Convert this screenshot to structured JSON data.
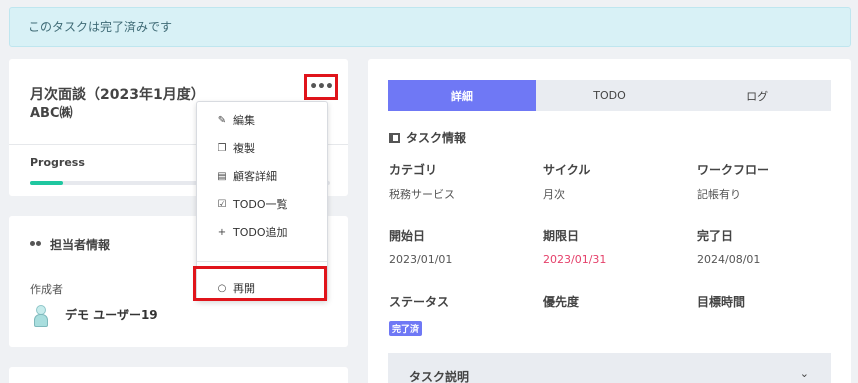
{
  "alert": {
    "text": "このタスクは完了済みです"
  },
  "task": {
    "title": "月次面談（2023年1月度）",
    "client": "ABC㈱",
    "progress_label": "Progress",
    "progress_value": 0.11,
    "more_label": "•••"
  },
  "menu": {
    "items": [
      {
        "icon": "pencil-icon",
        "label": "編集"
      },
      {
        "icon": "copy-icon",
        "label": "複製"
      },
      {
        "icon": "document-icon",
        "label": "顧客詳細"
      },
      {
        "icon": "checkbox-icon",
        "label": "TODO一覧"
      },
      {
        "icon": "plus-icon",
        "label": "TODO追加"
      }
    ],
    "reopen": {
      "icon": "circle-icon",
      "label": "再開"
    }
  },
  "assignee": {
    "section_title": "担当者情報",
    "creator_label": "作成者",
    "creator_name": "デモ ユーザー19"
  },
  "tabs": [
    {
      "label": "詳細",
      "active": true
    },
    {
      "label": "TODO",
      "active": false
    },
    {
      "label": "ログ",
      "active": false
    }
  ],
  "info": {
    "section_title": "タスク情報",
    "category": {
      "label": "カテゴリ",
      "value": "税務サービス"
    },
    "cycle": {
      "label": "サイクル",
      "value": "月次"
    },
    "workflow": {
      "label": "ワークフロー",
      "value": "記帳有り"
    },
    "start": {
      "label": "開始日",
      "value": "2023/01/01"
    },
    "due": {
      "label": "期限日",
      "value": "2023/01/31"
    },
    "done": {
      "label": "完了日",
      "value": "2024/08/01"
    },
    "status": {
      "label": "ステータス",
      "value": "完了済"
    },
    "priority": {
      "label": "優先度"
    },
    "target_time": {
      "label": "目標時間"
    }
  },
  "description": {
    "title": "タスク説明",
    "chevron": "⌄"
  },
  "colors": {
    "accent": "#6f78f5",
    "progress": "#1fc7a0",
    "due_date": "#e5406a",
    "highlight_border": "#e0141b"
  }
}
